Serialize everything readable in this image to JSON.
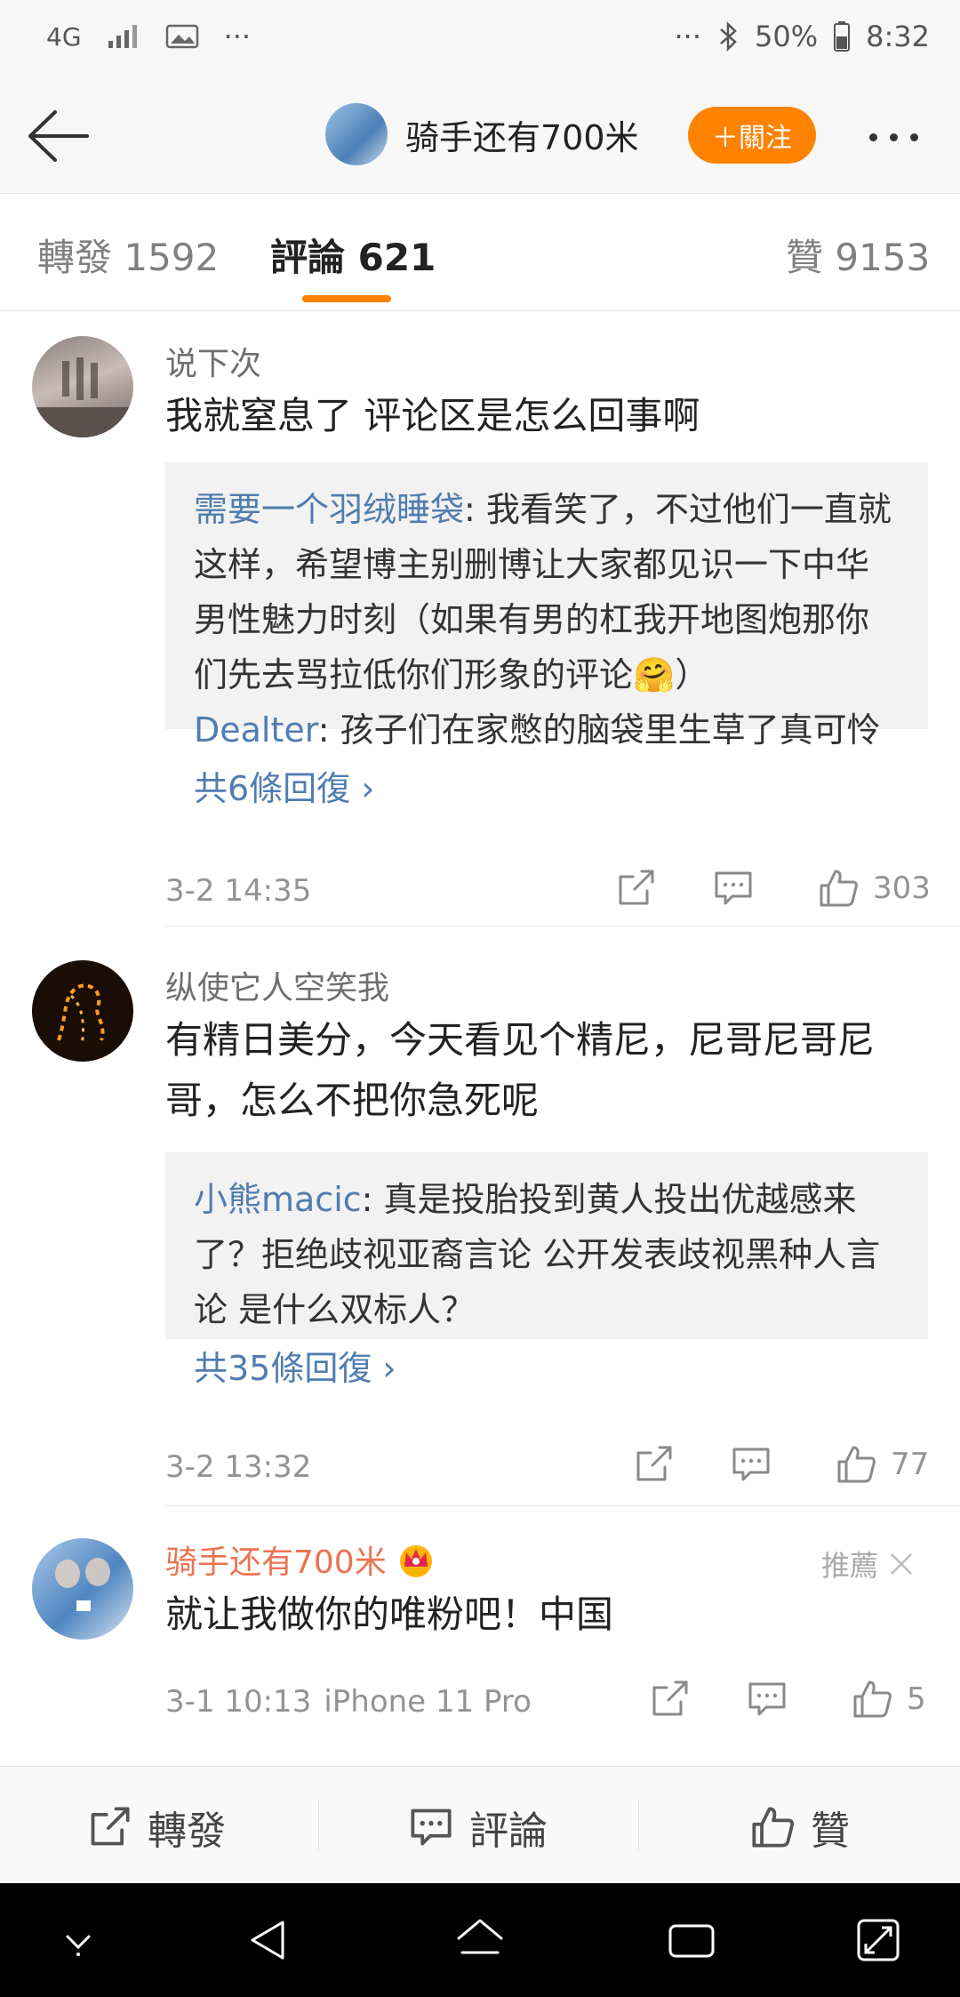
{
  "status_bar": {
    "network": "4G",
    "dots_left": "···",
    "dots_right": "···",
    "battery": "50%",
    "time": "8:32"
  },
  "nav": {
    "title": "骑手还有700米",
    "follow_label": "＋關注"
  },
  "tabs": {
    "repost": "轉發 1592",
    "comments": "評論 621",
    "likes": "贊 9153"
  },
  "comments": [
    {
      "user": "说下次",
      "text": "我就窒息了 评论区是怎么回事啊",
      "replies": [
        {
          "name": "需要一个羽绒睡袋",
          "text": ": 我看笑了，不过他们一直就这样，希望博主别删博让大家都见识一下中华男性魅力时刻（如果有男的杠我开地图炮那你们先去骂拉低你们形象的评论🤗）"
        },
        {
          "name": "Dealter",
          "text": ": 孩子们在家憋的脑袋里生草了真可怜"
        }
      ],
      "more": "共6條回復 ›",
      "time": "3-2 14:35",
      "likes": "303"
    },
    {
      "user": "纵使它人空笑我",
      "text": "有精日美分，今天看见个精尼，尼哥尼哥尼哥，怎么不把你急死呢",
      "replies": [
        {
          "name": "小熊macic",
          "text": ": 真是投胎投到黄人投出优越感来了？拒绝歧视亚裔言论 公开发表歧视黑种人言论 是什么双标人？"
        }
      ],
      "more": "共35條回復 ›",
      "time": "3-2 13:32",
      "likes": "77"
    },
    {
      "user": "骑手还有700米",
      "text": "就让我做你的唯粉吧！中国",
      "recommend": "推薦",
      "time": "3-1 10:13",
      "device": "iPhone 11 Pro",
      "likes": "5"
    }
  ],
  "bottom_bar": {
    "repost": "轉發",
    "comment": "評論",
    "like": "贊"
  }
}
